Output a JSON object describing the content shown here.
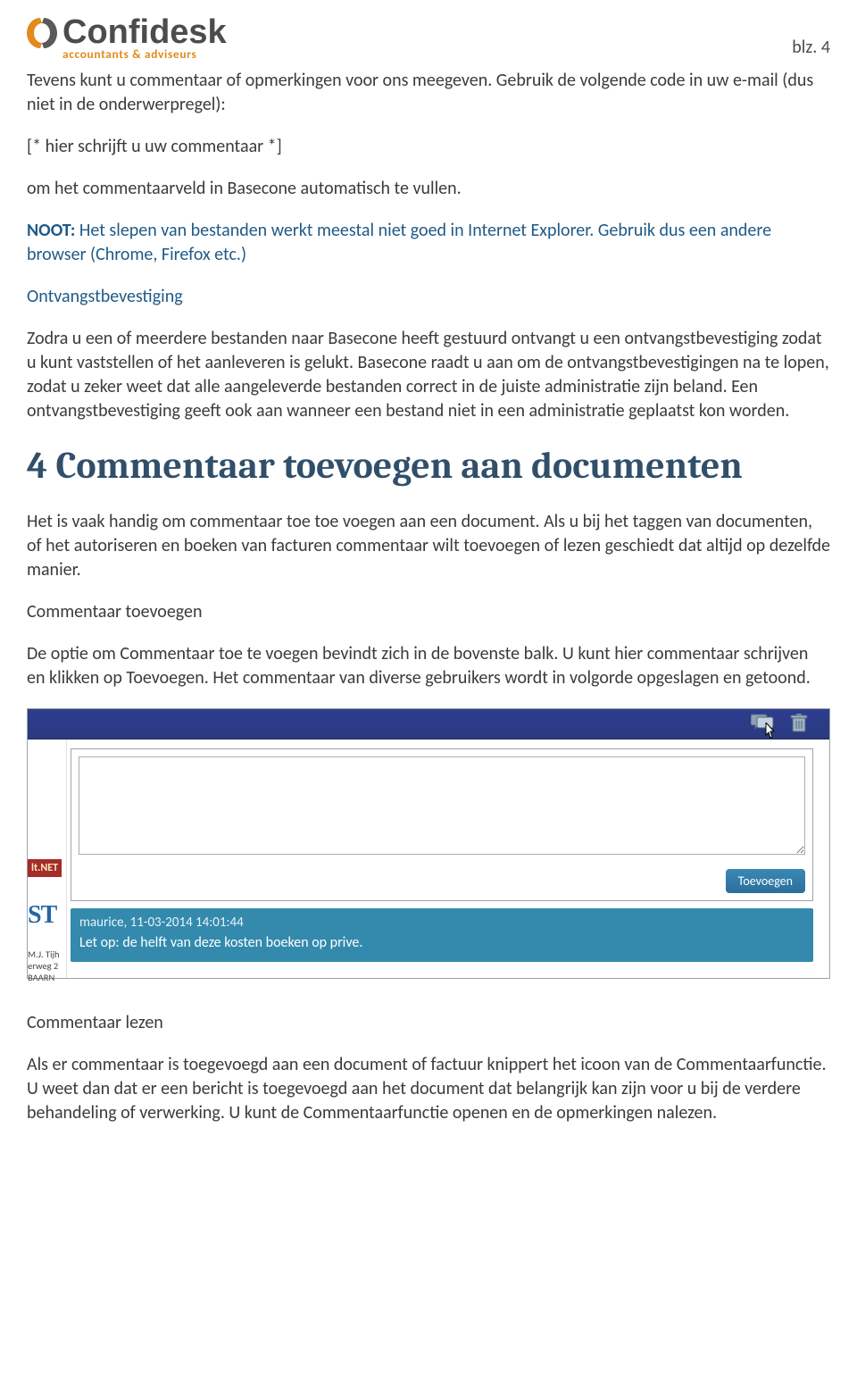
{
  "header": {
    "logo_word": "Confidesk",
    "logo_tagline": "accountants & adviseurs",
    "page_label": "blz. 4"
  },
  "paragraphs": {
    "p1": "Tevens kunt u commentaar of opmerkingen voor ons meegeven. Gebruik de volgende code in uw e-mail (dus niet in de onderwerpregel):",
    "p2": "[* hier schrijft u uw commentaar *]",
    "p3": "om het commentaarveld in Basecone automatisch te vullen.",
    "note_bold": "NOOT:",
    "note_rest": " Het slepen van bestanden werkt meestal niet goed in Internet Explorer. Gebruik dus een andere browser (Chrome, Firefox etc.)",
    "sub1": "Ontvangstbevestiging",
    "p4": "Zodra u een of meerdere bestanden naar Basecone heeft gestuurd ontvangt u een ontvangstbevestiging zodat u kunt vaststellen of het aanleveren is gelukt. Basecone raadt u aan om de ontvangstbevestigingen na te lopen, zodat u zeker weet dat alle aangeleverde bestanden correct in de juiste administratie zijn beland. Een ontvangstbevestiging geeft ook aan wanneer een bestand niet in een administratie geplaatst kon worden.",
    "section_heading": "4  Commentaar toevoegen aan documenten",
    "p5": "Het is vaak handig om commentaar toe toe voegen aan een document. Als u bij het taggen van documenten, of het autoriseren en boeken van facturen commentaar wilt toevoegen of lezen geschiedt dat altijd op dezelfde manier.",
    "sub2": "Commentaar toevoegen",
    "p6": "De optie om Commentaar toe te voegen bevindt zich in de bovenste balk. U kunt hier commentaar schrijven en klikken op Toevoegen. Het commentaar van diverse gebruikers wordt in volgorde opgeslagen en getoond.",
    "sub3": "Commentaar lezen",
    "p7": "Als er commentaar is toegevoegd aan een document of factuur knippert het icoon van de Commentaarfunctie. U weet dan dat er een bericht is toegevoegd aan het document dat belangrijk kan zijn voor u bij de verdere behandeling of verwerking. U kunt de Commentaarfunctie openen en de opmerkingen nalezen."
  },
  "screenshot": {
    "add_button": "Toevoegen",
    "left_tag": "lt.NET",
    "left_big": "ST",
    "left_addr_1": "M.J. Tijh",
    "left_addr_2": "erweg 2",
    "left_addr_3": "BAARN",
    "comment_meta": "maurice, 11-03-2014 14:01:44",
    "comment_text": "Let op: de helft van deze kosten boeken op prive."
  }
}
